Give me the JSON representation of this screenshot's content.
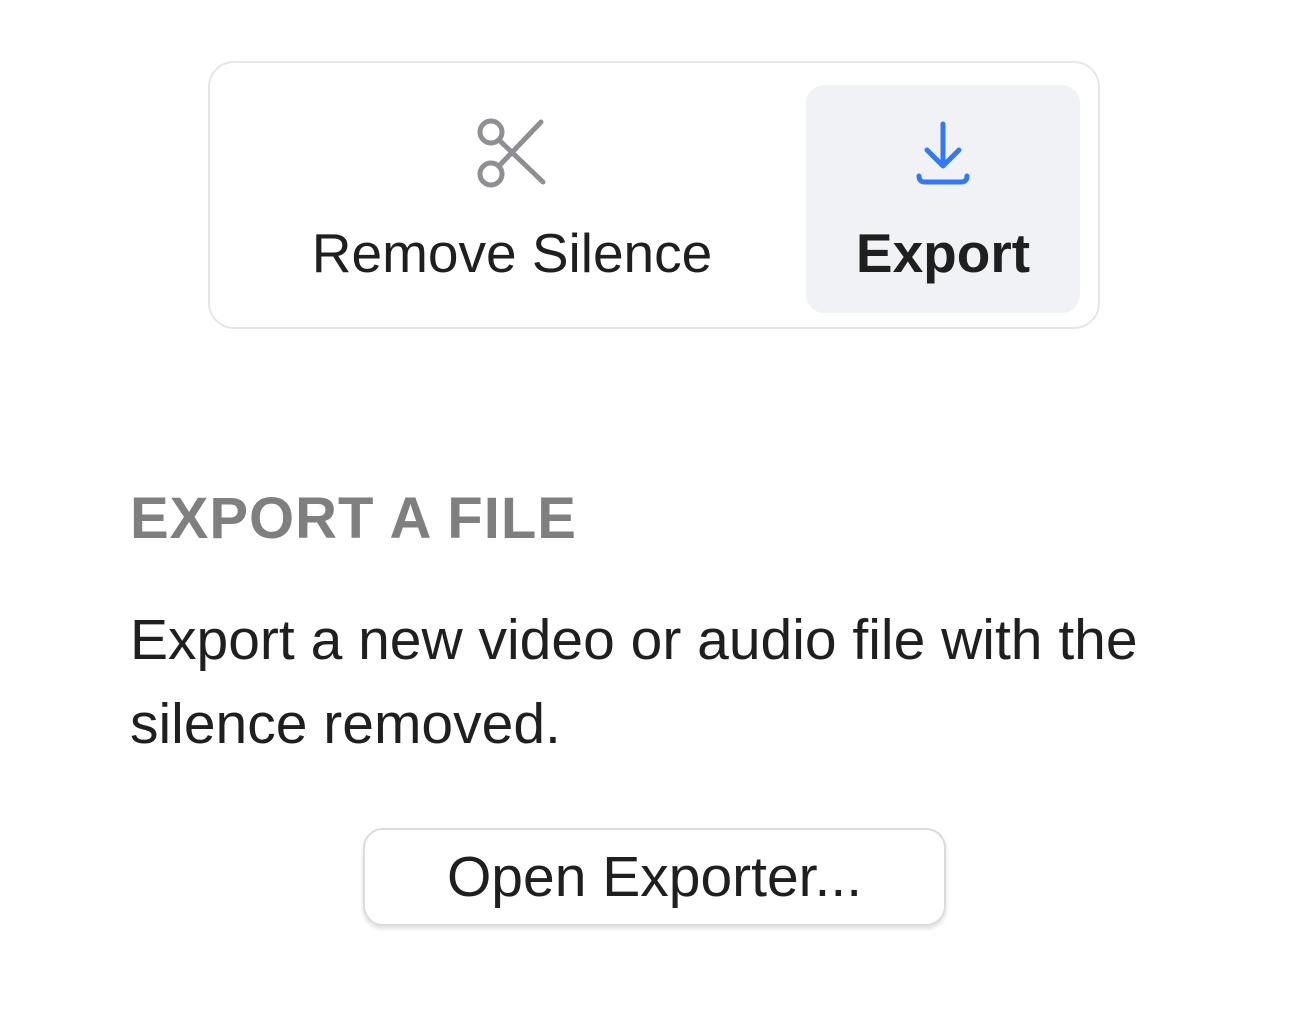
{
  "toolbar": {
    "items": [
      {
        "label": "Remove Silence",
        "icon": "scissors-icon",
        "selected": false,
        "icon_color": "#8e8e93"
      },
      {
        "label": "Export",
        "icon": "download-icon",
        "selected": true,
        "icon_color": "#3478f6"
      }
    ]
  },
  "section": {
    "title": "EXPORT A FILE",
    "description": "Export a new video or audio file with the silence removed."
  },
  "actions": {
    "open_exporter_label": "Open Exporter..."
  },
  "colors": {
    "accent": "#3478f6",
    "selected_background": "#f1f2f5",
    "section_title": "#7f7f7f"
  }
}
